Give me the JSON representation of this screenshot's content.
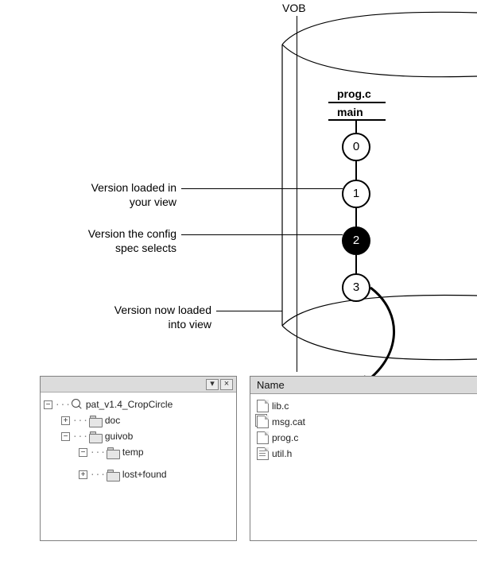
{
  "diagram": {
    "title": "VOB",
    "file_label": "prog.c",
    "branch_label": "main",
    "versions": [
      "0",
      "1",
      "2",
      "3"
    ],
    "selected_version_index": 2,
    "annotations": {
      "loaded_in_view": "Version loaded in your view",
      "config_spec_selects": "Version the config spec selects",
      "now_loaded": "Version now loaded into view"
    }
  },
  "tree": {
    "root": "pat_v1.4_CropCircle",
    "items": [
      {
        "label": "doc",
        "expander": "+"
      },
      {
        "label": "guivob",
        "expander": "−"
      },
      {
        "label": "temp",
        "expander": "−"
      },
      {
        "label": "lost+found",
        "expander": "+"
      }
    ]
  },
  "list": {
    "header": "Name",
    "files": [
      {
        "name": "lib.c",
        "kind": "c"
      },
      {
        "name": "msg.cat",
        "kind": "cat"
      },
      {
        "name": "prog.c",
        "kind": "c"
      },
      {
        "name": "util.h",
        "kind": "h"
      }
    ]
  }
}
